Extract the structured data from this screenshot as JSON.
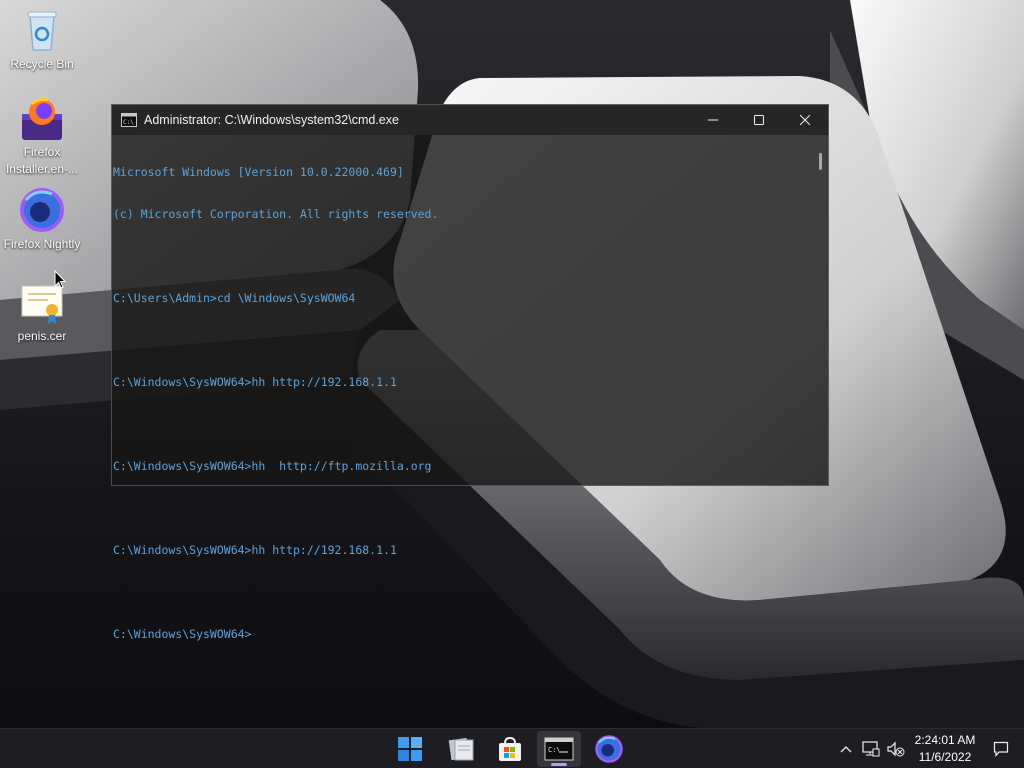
{
  "desktop": {
    "icons": [
      {
        "label": "Recycle Bin",
        "icon": "recycle-bin-icon"
      },
      {
        "label": "Firefox Installer.en-...",
        "icon": "firefox-installer-icon"
      },
      {
        "label": "Firefox Nightly",
        "icon": "firefox-nightly-icon"
      },
      {
        "label": "penis.cer",
        "icon": "certificate-icon"
      }
    ]
  },
  "window": {
    "title": "Administrator: C:\\Windows\\system32\\cmd.exe",
    "controls": [
      "minimize-icon",
      "maximize-icon",
      "close-icon"
    ],
    "console_lines": [
      "Microsoft Windows [Version 10.0.22000.469]",
      "(c) Microsoft Corporation. All rights reserved.",
      "",
      "C:\\Users\\Admin>cd \\Windows\\SysWOW64",
      "",
      "C:\\Windows\\SysWOW64>hh http://192.168.1.1",
      "",
      "C:\\Windows\\SysWOW64>hh  http://ftp.mozilla.org",
      "",
      "C:\\Windows\\SysWOW64>hh http://192.168.1.1",
      "",
      "C:\\Windows\\SysWOW64>"
    ],
    "text_color": "#5fa2d6"
  },
  "taskbar": {
    "apps": [
      "start-icon",
      "file-explorer-icon",
      "microsoft-store-icon",
      "command-prompt-icon",
      "firefox-nightly-icon"
    ],
    "active_app": "command-prompt-icon",
    "tray": [
      "chevron-up-icon",
      "network-icon",
      "volume-muted-icon"
    ],
    "time": "2:24:01 AM",
    "date": "11/6/2022",
    "notification_icon": "notification-icon"
  }
}
